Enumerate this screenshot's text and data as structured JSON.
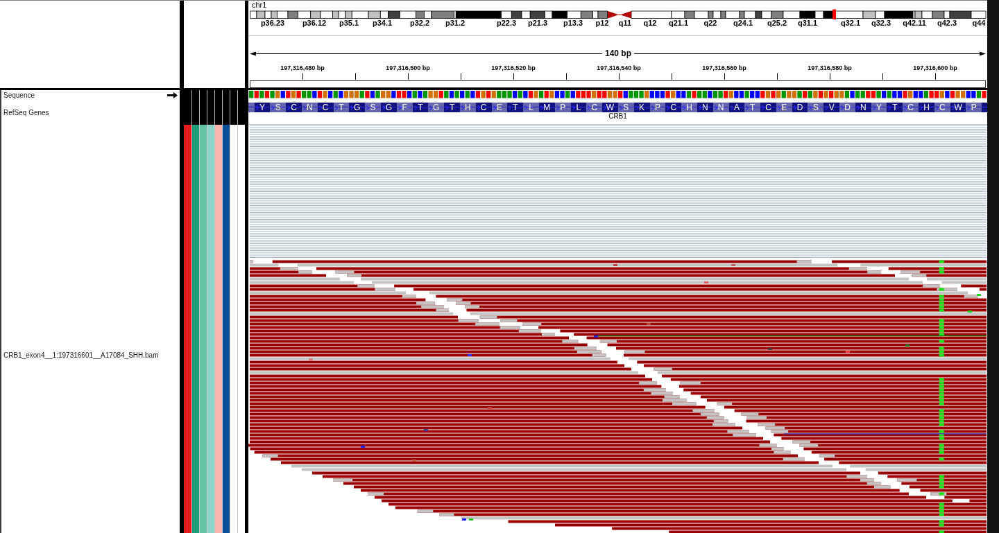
{
  "header": {
    "chromosome": "chr1",
    "cytobands": [
      "p36.23",
      "p36.12",
      "p35.1",
      "p34.1",
      "p32.2",
      "p31.2",
      "p22.3",
      "p21.3",
      "p13.3",
      "p12",
      "q11",
      "q12",
      "q21.1",
      "q22",
      "q24.1",
      "q25.2",
      "q31.1",
      "q32.1",
      "q32.3",
      "q42.11",
      "q42.3",
      "q44"
    ],
    "ruler": {
      "span": "140 bp",
      "ticks": [
        "197,316,480 bp",
        "197,316,500 bp",
        "197,316,520 bp",
        "197,316,540 bp",
        "197,316,560 bp",
        "197,316,580 bp",
        "197,316,600 bp"
      ]
    }
  },
  "attributes": [
    {
      "color": "#e41a1c"
    },
    {
      "color": "#1b9e77"
    },
    {
      "color": "#66c2a5"
    },
    {
      "color": "#8dd3c7"
    },
    {
      "color": "#fbb4ae"
    },
    {
      "color": "#0b4d96"
    },
    {
      "color": "#ffffff"
    },
    {
      "color": "#ffffff"
    }
  ],
  "tracks": [
    {
      "kind": "sequence",
      "name": "Sequence",
      "bases": [
        {
          "color": "#009600"
        },
        {
          "color": "#ff0000"
        },
        {
          "color": "#009600"
        },
        {
          "color": "#ff0000"
        },
        {
          "color": "#009600"
        },
        {
          "color": "#d17105"
        },
        {
          "color": "#0000ff"
        },
        {
          "color": "#ff0000"
        },
        {
          "color": "#d17105"
        },
        {
          "color": "#ff0000"
        },
        {
          "color": "#009600"
        },
        {
          "color": "#009600"
        },
        {
          "color": "#0000ff"
        },
        {
          "color": "#ff0000"
        },
        {
          "color": "#d17105"
        },
        {
          "color": "#0000ff"
        },
        {
          "color": "#009600"
        },
        {
          "color": "#0000ff"
        },
        {
          "color": "#d17105"
        },
        {
          "color": "#d17105"
        },
        {
          "color": "#d17105"
        },
        {
          "color": "#009600"
        },
        {
          "color": "#ff0000"
        },
        {
          "color": "#0000ff"
        },
        {
          "color": "#009600"
        },
        {
          "color": "#d17105"
        },
        {
          "color": "#d17105"
        },
        {
          "color": "#0000ff"
        },
        {
          "color": "#ff0000"
        },
        {
          "color": "#ff0000"
        },
        {
          "color": "#0000ff"
        },
        {
          "color": "#009600"
        },
        {
          "color": "#0000ff"
        },
        {
          "color": "#009600"
        },
        {
          "color": "#d17105"
        },
        {
          "color": "#d17105"
        },
        {
          "color": "#ff0000"
        },
        {
          "color": "#009600"
        },
        {
          "color": "#0000ff"
        },
        {
          "color": "#009600"
        },
        {
          "color": "#0000ff"
        },
        {
          "color": "#009600"
        },
        {
          "color": "#0000ff"
        },
        {
          "color": "#ff0000"
        },
        {
          "color": "#d17105"
        },
        {
          "color": "#ff0000"
        },
        {
          "color": "#d17105"
        },
        {
          "color": "#009600"
        },
        {
          "color": "#009600"
        },
        {
          "color": "#009600"
        },
        {
          "color": "#0000ff"
        },
        {
          "color": "#009600"
        },
        {
          "color": "#0000ff"
        },
        {
          "color": "#ff0000"
        },
        {
          "color": "#d17105"
        },
        {
          "color": "#009600"
        },
        {
          "color": "#ff0000"
        },
        {
          "color": "#d17105"
        },
        {
          "color": "#0000ff"
        },
        {
          "color": "#0000ff"
        },
        {
          "color": "#009600"
        },
        {
          "color": "#0000ff"
        },
        {
          "color": "#ff0000"
        },
        {
          "color": "#ff0000"
        },
        {
          "color": "#ff0000"
        },
        {
          "color": "#d17105"
        },
        {
          "color": "#ff0000"
        },
        {
          "color": "#ff0000"
        },
        {
          "color": "#d17105"
        },
        {
          "color": "#d17105"
        },
        {
          "color": "#ff0000"
        },
        {
          "color": "#0000ff"
        },
        {
          "color": "#009600"
        },
        {
          "color": "#009600"
        },
        {
          "color": "#009600"
        },
        {
          "color": "#d17105"
        },
        {
          "color": "#0000ff"
        },
        {
          "color": "#0000ff"
        },
        {
          "color": "#0000ff"
        },
        {
          "color": "#ff0000"
        },
        {
          "color": "#d17105"
        },
        {
          "color": "#0000ff"
        },
        {
          "color": "#0000ff"
        },
        {
          "color": "#009600"
        },
        {
          "color": "#ff0000"
        },
        {
          "color": "#009600"
        },
        {
          "color": "#009600"
        },
        {
          "color": "#0000ff"
        },
        {
          "color": "#009600"
        },
        {
          "color": "#009600"
        },
        {
          "color": "#ff0000"
        },
        {
          "color": "#d17105"
        },
        {
          "color": "#0000ff"
        },
        {
          "color": "#0000ff"
        },
        {
          "color": "#009600"
        },
        {
          "color": "#0000ff"
        },
        {
          "color": "#0000ff"
        },
        {
          "color": "#ff0000"
        },
        {
          "color": "#d17105"
        },
        {
          "color": "#ff0000"
        },
        {
          "color": "#d17105"
        },
        {
          "color": "#009600"
        },
        {
          "color": "#d17105"
        },
        {
          "color": "#d17105"
        },
        {
          "color": "#009600"
        },
        {
          "color": "#ff0000"
        },
        {
          "color": "#009600"
        },
        {
          "color": "#d17105"
        },
        {
          "color": "#ff0000"
        },
        {
          "color": "#d17105"
        },
        {
          "color": "#ff0000"
        },
        {
          "color": "#d17105"
        },
        {
          "color": "#d17105"
        },
        {
          "color": "#009600"
        },
        {
          "color": "#0000ff"
        },
        {
          "color": "#009600"
        },
        {
          "color": "#009600"
        },
        {
          "color": "#ff0000"
        },
        {
          "color": "#ff0000"
        },
        {
          "color": "#009600"
        },
        {
          "color": "#0000ff"
        },
        {
          "color": "#009600"
        },
        {
          "color": "#0000ff"
        },
        {
          "color": "#0000ff"
        },
        {
          "color": "#ff0000"
        },
        {
          "color": "#d17105"
        },
        {
          "color": "#0000ff"
        },
        {
          "color": "#0000ff"
        },
        {
          "color": "#009600"
        },
        {
          "color": "#ff0000"
        },
        {
          "color": "#ff0000"
        },
        {
          "color": "#d17105"
        },
        {
          "color": "#0000ff"
        },
        {
          "color": "#ff0000"
        },
        {
          "color": "#d17105"
        },
        {
          "color": "#d17105"
        },
        {
          "color": "#0000ff"
        },
        {
          "color": "#0000ff"
        },
        {
          "color": "#009600"
        },
        {
          "color": "#ff0000"
        }
      ]
    },
    {
      "kind": "gene",
      "name": "RefSeq Genes",
      "gene": "CRB1",
      "amino_acids": [
        "Y",
        "S",
        "C",
        "N",
        "C",
        "T",
        "G",
        "S",
        "G",
        "F",
        "T",
        "G",
        "T",
        "H",
        "C",
        "E",
        "T",
        "L",
        "M",
        "P",
        "L",
        "C",
        "W",
        "S",
        "K",
        "P",
        "C",
        "H",
        "N",
        "N",
        "A",
        "T",
        "C",
        "E",
        "D",
        "S",
        "V",
        "D",
        "N",
        "Y",
        "T",
        "C",
        "H",
        "C",
        "W",
        "P"
      ]
    },
    {
      "kind": "alignment",
      "name": "CRB1_exon4__1:197316601__A17084_SHH.bam"
    }
  ]
}
